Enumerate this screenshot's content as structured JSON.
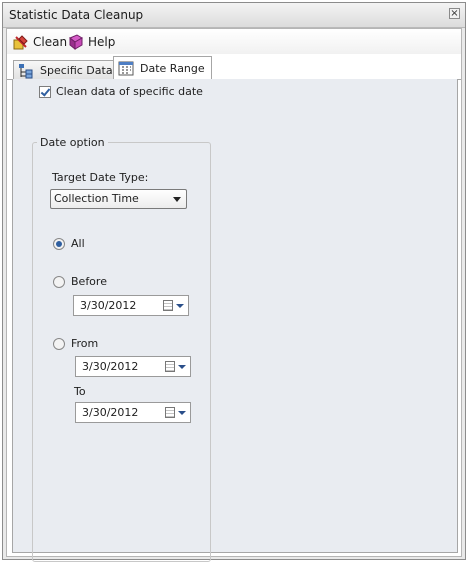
{
  "window": {
    "title": "Statistic Data Cleanup"
  },
  "toolbar": {
    "clean_label": "Clean",
    "help_label": "Help"
  },
  "tabs": [
    {
      "label": "Specific Data",
      "active": false
    },
    {
      "label": "Date Range",
      "active": true
    }
  ],
  "panel": {
    "clean_checkbox": {
      "label": "Clean data of specific date",
      "checked": true
    },
    "group_title": "Date option",
    "target_label": "Target Date Type:",
    "target_select": {
      "value": "Collection Time"
    },
    "radio_all": {
      "label": "All",
      "checked": true
    },
    "radio_before": {
      "label": "Before",
      "checked": false
    },
    "before_date": "3/30/2012",
    "radio_from": {
      "label": "From",
      "checked": false
    },
    "from_date": "3/30/2012",
    "to_label": "To",
    "to_date": "3/30/2012"
  },
  "colors": {
    "accent": "#2f5fa0",
    "panel_bg": "#e9ecf1",
    "chrome_bg": "#e9e9e9"
  }
}
